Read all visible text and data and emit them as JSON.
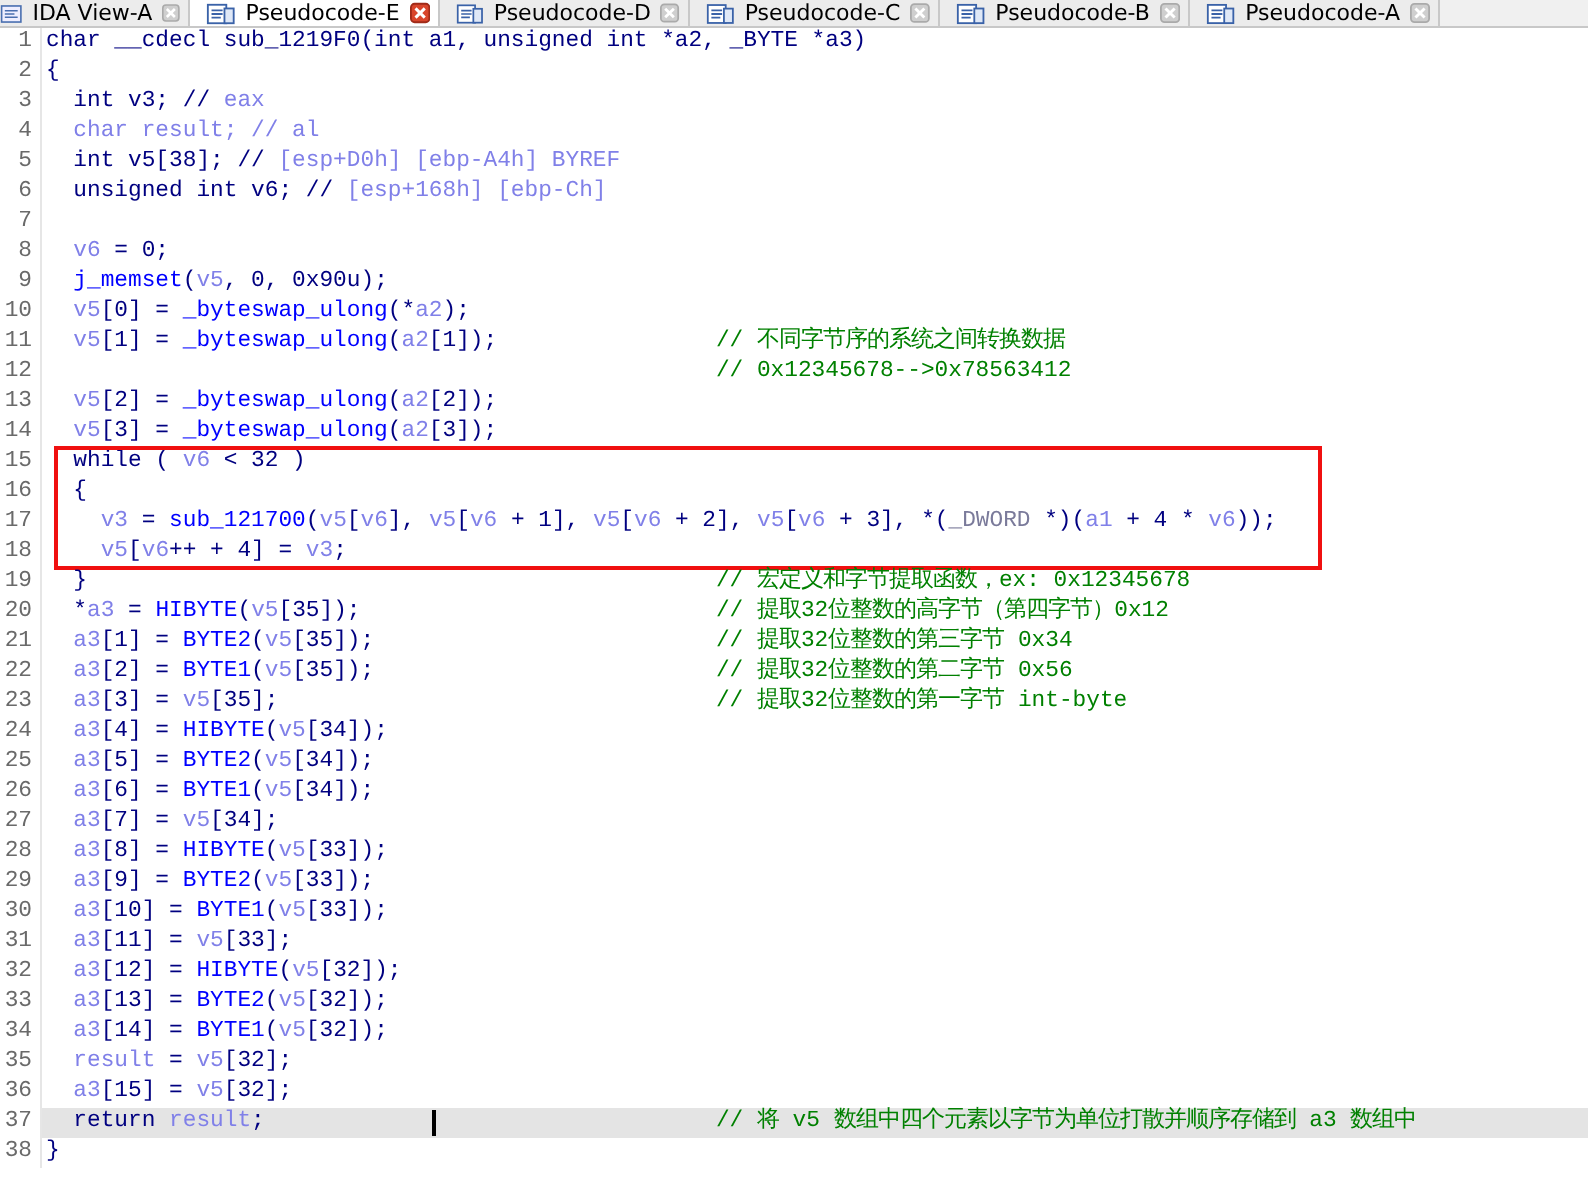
{
  "tabs": [
    {
      "label": "IDA View-A",
      "kind": "disasm",
      "selected": false
    },
    {
      "label": "Pseudocode-E",
      "kind": "pseudo",
      "selected": true
    },
    {
      "label": "Pseudocode-D",
      "kind": "pseudo",
      "selected": false
    },
    {
      "label": "Pseudocode-C",
      "kind": "pseudo",
      "selected": false
    },
    {
      "label": "Pseudocode-B",
      "kind": "pseudo",
      "selected": false
    },
    {
      "label": "Pseudocode-A",
      "kind": "pseudo",
      "selected": false
    }
  ],
  "lines": [
    {
      "number": "1",
      "selected": false,
      "boxed": false,
      "segments": [
        {
          "kind": "plain",
          "text": "char __cdecl sub_1219F0(int a1, unsigned int *a2, _BYTE *a3)"
        }
      ]
    },
    {
      "number": "2",
      "selected": false,
      "boxed": false,
      "segments": [
        {
          "kind": "plain",
          "text": "{"
        }
      ]
    },
    {
      "number": "3",
      "selected": false,
      "boxed": false,
      "segments": [
        {
          "kind": "plain",
          "text": "  int v3; // "
        },
        {
          "kind": "var",
          "text": "eax"
        }
      ]
    },
    {
      "number": "4",
      "selected": false,
      "boxed": false,
      "segments": [
        {
          "kind": "var",
          "text": "  char result; // al"
        }
      ]
    },
    {
      "number": "5",
      "selected": false,
      "boxed": false,
      "segments": [
        {
          "kind": "plain",
          "text": "  int v5[38]; // "
        },
        {
          "kind": "var",
          "text": "[esp+D0h] [ebp-A4h] BYREF"
        }
      ]
    },
    {
      "number": "6",
      "selected": false,
      "boxed": false,
      "segments": [
        {
          "kind": "plain",
          "text": "  unsigned int v6; // "
        },
        {
          "kind": "var",
          "text": "[esp+168h] [ebp-Ch]"
        }
      ]
    },
    {
      "number": "7",
      "selected": false,
      "boxed": false
    },
    {
      "number": "8",
      "selected": false,
      "boxed": false,
      "segments": [
        {
          "kind": "var",
          "text": "  v6"
        },
        {
          "kind": "plain",
          "text": " = 0;"
        }
      ]
    },
    {
      "number": "9",
      "selected": false,
      "boxed": false,
      "segments": [
        {
          "kind": "func",
          "text": "  j_memset"
        },
        {
          "kind": "plain",
          "text": "("
        },
        {
          "kind": "var",
          "text": "v5"
        },
        {
          "kind": "plain",
          "text": ", 0, 0x90u);"
        }
      ]
    },
    {
      "number": "10",
      "selected": false,
      "boxed": false,
      "segments": [
        {
          "kind": "var",
          "text": "  v5"
        },
        {
          "kind": "plain",
          "text": "[0] = "
        },
        {
          "kind": "func",
          "text": "_byteswap_ulong"
        },
        {
          "kind": "plain",
          "text": "(*"
        },
        {
          "kind": "var",
          "text": "a2"
        },
        {
          "kind": "plain",
          "text": ");"
        }
      ]
    },
    {
      "number": "11",
      "selected": false,
      "boxed": false,
      "segments": [
        {
          "kind": "var",
          "text": "  v5"
        },
        {
          "kind": "plain",
          "text": "[1] = "
        },
        {
          "kind": "func",
          "text": "_byteswap_ulong"
        },
        {
          "kind": "plain",
          "text": "("
        },
        {
          "kind": "var",
          "text": "a2"
        },
        {
          "kind": "plain",
          "text": "[1]);"
        }
      ],
      "comment": "// 不同字节序的系统之间转换数据"
    },
    {
      "number": "12",
      "selected": false,
      "boxed": false,
      "comment": "// 0x12345678-->0x78563412"
    },
    {
      "number": "13",
      "selected": false,
      "boxed": false,
      "segments": [
        {
          "kind": "var",
          "text": "  v5"
        },
        {
          "kind": "plain",
          "text": "[2] = "
        },
        {
          "kind": "func",
          "text": "_byteswap_ulong"
        },
        {
          "kind": "plain",
          "text": "("
        },
        {
          "kind": "var",
          "text": "a2"
        },
        {
          "kind": "plain",
          "text": "[2]);"
        }
      ]
    },
    {
      "number": "14",
      "selected": false,
      "boxed": false,
      "segments": [
        {
          "kind": "var",
          "text": "  v5"
        },
        {
          "kind": "plain",
          "text": "[3] = "
        },
        {
          "kind": "func",
          "text": "_byteswap_ulong"
        },
        {
          "kind": "plain",
          "text": "("
        },
        {
          "kind": "var",
          "text": "a2"
        },
        {
          "kind": "plain",
          "text": "[3]);"
        }
      ]
    },
    {
      "number": "15",
      "selected": false,
      "boxed": true,
      "segments": [
        {
          "kind": "plain",
          "text": "  while ( "
        },
        {
          "kind": "var",
          "text": "v6"
        },
        {
          "kind": "plain",
          "text": " < 32 )"
        }
      ]
    },
    {
      "number": "16",
      "selected": false,
      "boxed": true,
      "segments": [
        {
          "kind": "plain",
          "text": "  {"
        }
      ]
    },
    {
      "number": "17",
      "selected": false,
      "boxed": true,
      "segments": [
        {
          "kind": "var",
          "text": "    v3"
        },
        {
          "kind": "plain",
          "text": " = "
        },
        {
          "kind": "func",
          "text": "sub_121700"
        },
        {
          "kind": "plain",
          "text": "("
        },
        {
          "kind": "var",
          "text": "v5"
        },
        {
          "kind": "plain",
          "text": "["
        },
        {
          "kind": "var",
          "text": "v6"
        },
        {
          "kind": "plain",
          "text": "], "
        },
        {
          "kind": "var",
          "text": "v5"
        },
        {
          "kind": "plain",
          "text": "["
        },
        {
          "kind": "var",
          "text": "v6"
        },
        {
          "kind": "plain",
          "text": " + 1], "
        },
        {
          "kind": "var",
          "text": "v5"
        },
        {
          "kind": "plain",
          "text": "["
        },
        {
          "kind": "var",
          "text": "v6"
        },
        {
          "kind": "plain",
          "text": " + 2], "
        },
        {
          "kind": "var",
          "text": "v5"
        },
        {
          "kind": "plain",
          "text": "["
        },
        {
          "kind": "var",
          "text": "v6"
        },
        {
          "kind": "plain",
          "text": " + 3], *("
        },
        {
          "kind": "type",
          "text": "_DWORD"
        },
        {
          "kind": "plain",
          "text": " *)("
        },
        {
          "kind": "var",
          "text": "a1"
        },
        {
          "kind": "plain",
          "text": " + 4 * "
        },
        {
          "kind": "var",
          "text": "v6"
        },
        {
          "kind": "plain",
          "text": "));"
        }
      ]
    },
    {
      "number": "18",
      "selected": false,
      "boxed": true,
      "segments": [
        {
          "kind": "var",
          "text": "    v5"
        },
        {
          "kind": "plain",
          "text": "["
        },
        {
          "kind": "var",
          "text": "v6"
        },
        {
          "kind": "plain",
          "text": "++ + 4] = "
        },
        {
          "kind": "var",
          "text": "v3"
        },
        {
          "kind": "plain",
          "text": ";"
        }
      ]
    },
    {
      "number": "19",
      "selected": false,
      "boxed": false,
      "segments": [
        {
          "kind": "plain",
          "text": "  }"
        }
      ],
      "comment": "// 宏定义和字节提取函数，ex: 0x12345678"
    },
    {
      "number": "20",
      "selected": false,
      "boxed": false,
      "segments": [
        {
          "kind": "plain",
          "text": "  *"
        },
        {
          "kind": "var",
          "text": "a3"
        },
        {
          "kind": "plain",
          "text": " = "
        },
        {
          "kind": "func",
          "text": "HIBYTE"
        },
        {
          "kind": "plain",
          "text": "("
        },
        {
          "kind": "var",
          "text": "v5"
        },
        {
          "kind": "plain",
          "text": "[35]);"
        }
      ],
      "comment": "// 提取32位整数的高字节（第四字节）0x12"
    },
    {
      "number": "21",
      "selected": false,
      "boxed": false,
      "segments": [
        {
          "kind": "var",
          "text": "  a3"
        },
        {
          "kind": "plain",
          "text": "[1] = "
        },
        {
          "kind": "func",
          "text": "BYTE2"
        },
        {
          "kind": "plain",
          "text": "("
        },
        {
          "kind": "var",
          "text": "v5"
        },
        {
          "kind": "plain",
          "text": "[35]);"
        }
      ],
      "comment": "// 提取32位整数的第三字节 0x34"
    },
    {
      "number": "22",
      "selected": false,
      "boxed": false,
      "segments": [
        {
          "kind": "var",
          "text": "  a3"
        },
        {
          "kind": "plain",
          "text": "[2] = "
        },
        {
          "kind": "func",
          "text": "BYTE1"
        },
        {
          "kind": "plain",
          "text": "("
        },
        {
          "kind": "var",
          "text": "v5"
        },
        {
          "kind": "plain",
          "text": "[35]);"
        }
      ],
      "comment": "// 提取32位整数的第二字节 0x56"
    },
    {
      "number": "23",
      "selected": false,
      "boxed": false,
      "segments": [
        {
          "kind": "var",
          "text": "  a3"
        },
        {
          "kind": "plain",
          "text": "[3] = "
        },
        {
          "kind": "var",
          "text": "v5"
        },
        {
          "kind": "plain",
          "text": "[35];"
        }
      ],
      "comment": "// 提取32位整数的第一字节 int-byte"
    },
    {
      "number": "24",
      "selected": false,
      "boxed": false,
      "segments": [
        {
          "kind": "var",
          "text": "  a3"
        },
        {
          "kind": "plain",
          "text": "[4] = "
        },
        {
          "kind": "func",
          "text": "HIBYTE"
        },
        {
          "kind": "plain",
          "text": "("
        },
        {
          "kind": "var",
          "text": "v5"
        },
        {
          "kind": "plain",
          "text": "[34]);"
        }
      ]
    },
    {
      "number": "25",
      "selected": false,
      "boxed": false,
      "segments": [
        {
          "kind": "var",
          "text": "  a3"
        },
        {
          "kind": "plain",
          "text": "[5] = "
        },
        {
          "kind": "func",
          "text": "BYTE2"
        },
        {
          "kind": "plain",
          "text": "("
        },
        {
          "kind": "var",
          "text": "v5"
        },
        {
          "kind": "plain",
          "text": "[34]);"
        }
      ]
    },
    {
      "number": "26",
      "selected": false,
      "boxed": false,
      "segments": [
        {
          "kind": "var",
          "text": "  a3"
        },
        {
          "kind": "plain",
          "text": "[6] = "
        },
        {
          "kind": "func",
          "text": "BYTE1"
        },
        {
          "kind": "plain",
          "text": "("
        },
        {
          "kind": "var",
          "text": "v5"
        },
        {
          "kind": "plain",
          "text": "[34]);"
        }
      ]
    },
    {
      "number": "27",
      "selected": false,
      "boxed": false,
      "segments": [
        {
          "kind": "var",
          "text": "  a3"
        },
        {
          "kind": "plain",
          "text": "[7] = "
        },
        {
          "kind": "var",
          "text": "v5"
        },
        {
          "kind": "plain",
          "text": "[34];"
        }
      ]
    },
    {
      "number": "28",
      "selected": false,
      "boxed": false,
      "segments": [
        {
          "kind": "var",
          "text": "  a3"
        },
        {
          "kind": "plain",
          "text": "[8] = "
        },
        {
          "kind": "func",
          "text": "HIBYTE"
        },
        {
          "kind": "plain",
          "text": "("
        },
        {
          "kind": "var",
          "text": "v5"
        },
        {
          "kind": "plain",
          "text": "[33]);"
        }
      ]
    },
    {
      "number": "29",
      "selected": false,
      "boxed": false,
      "segments": [
        {
          "kind": "var",
          "text": "  a3"
        },
        {
          "kind": "plain",
          "text": "[9] = "
        },
        {
          "kind": "func",
          "text": "BYTE2"
        },
        {
          "kind": "plain",
          "text": "("
        },
        {
          "kind": "var",
          "text": "v5"
        },
        {
          "kind": "plain",
          "text": "[33]);"
        }
      ]
    },
    {
      "number": "30",
      "selected": false,
      "boxed": false,
      "segments": [
        {
          "kind": "var",
          "text": "  a3"
        },
        {
          "kind": "plain",
          "text": "[10] = "
        },
        {
          "kind": "func",
          "text": "BYTE1"
        },
        {
          "kind": "plain",
          "text": "("
        },
        {
          "kind": "var",
          "text": "v5"
        },
        {
          "kind": "plain",
          "text": "[33]);"
        }
      ]
    },
    {
      "number": "31",
      "selected": false,
      "boxed": false,
      "segments": [
        {
          "kind": "var",
          "text": "  a3"
        },
        {
          "kind": "plain",
          "text": "[11] = "
        },
        {
          "kind": "var",
          "text": "v5"
        },
        {
          "kind": "plain",
          "text": "[33];"
        }
      ]
    },
    {
      "number": "32",
      "selected": false,
      "boxed": false,
      "segments": [
        {
          "kind": "var",
          "text": "  a3"
        },
        {
          "kind": "plain",
          "text": "[12] = "
        },
        {
          "kind": "func",
          "text": "HIBYTE"
        },
        {
          "kind": "plain",
          "text": "("
        },
        {
          "kind": "var",
          "text": "v5"
        },
        {
          "kind": "plain",
          "text": "[32]);"
        }
      ]
    },
    {
      "number": "33",
      "selected": false,
      "boxed": false,
      "segments": [
        {
          "kind": "var",
          "text": "  a3"
        },
        {
          "kind": "plain",
          "text": "[13] = "
        },
        {
          "kind": "func",
          "text": "BYTE2"
        },
        {
          "kind": "plain",
          "text": "("
        },
        {
          "kind": "var",
          "text": "v5"
        },
        {
          "kind": "plain",
          "text": "[32]);"
        }
      ]
    },
    {
      "number": "34",
      "selected": false,
      "boxed": false,
      "segments": [
        {
          "kind": "var",
          "text": "  a3"
        },
        {
          "kind": "plain",
          "text": "[14] = "
        },
        {
          "kind": "func",
          "text": "BYTE1"
        },
        {
          "kind": "plain",
          "text": "("
        },
        {
          "kind": "var",
          "text": "v5"
        },
        {
          "kind": "plain",
          "text": "[32]);"
        }
      ]
    },
    {
      "number": "35",
      "selected": false,
      "boxed": false,
      "segments": [
        {
          "kind": "var",
          "text": "  result"
        },
        {
          "kind": "plain",
          "text": " = "
        },
        {
          "kind": "var",
          "text": "v5"
        },
        {
          "kind": "plain",
          "text": "[32];"
        }
      ]
    },
    {
      "number": "36",
      "selected": false,
      "boxed": false,
      "segments": [
        {
          "kind": "var",
          "text": "  a3"
        },
        {
          "kind": "plain",
          "text": "[15] = "
        },
        {
          "kind": "var",
          "text": "v5"
        },
        {
          "kind": "plain",
          "text": "[32];"
        }
      ]
    },
    {
      "number": "37",
      "selected": true,
      "boxed": false,
      "cursor": true,
      "segments": [
        {
          "kind": "plain",
          "text": "  return "
        },
        {
          "kind": "var",
          "text": "result"
        },
        {
          "kind": "plain",
          "text": ";"
        }
      ],
      "comment": "// 将 v5 数组中四个元素以字节为单位打散并顺序存储到 a3 数组中"
    },
    {
      "number": "38",
      "selected": false,
      "boxed": false,
      "segments": [
        {
          "kind": "plain",
          "text": "}"
        }
      ]
    }
  ]
}
